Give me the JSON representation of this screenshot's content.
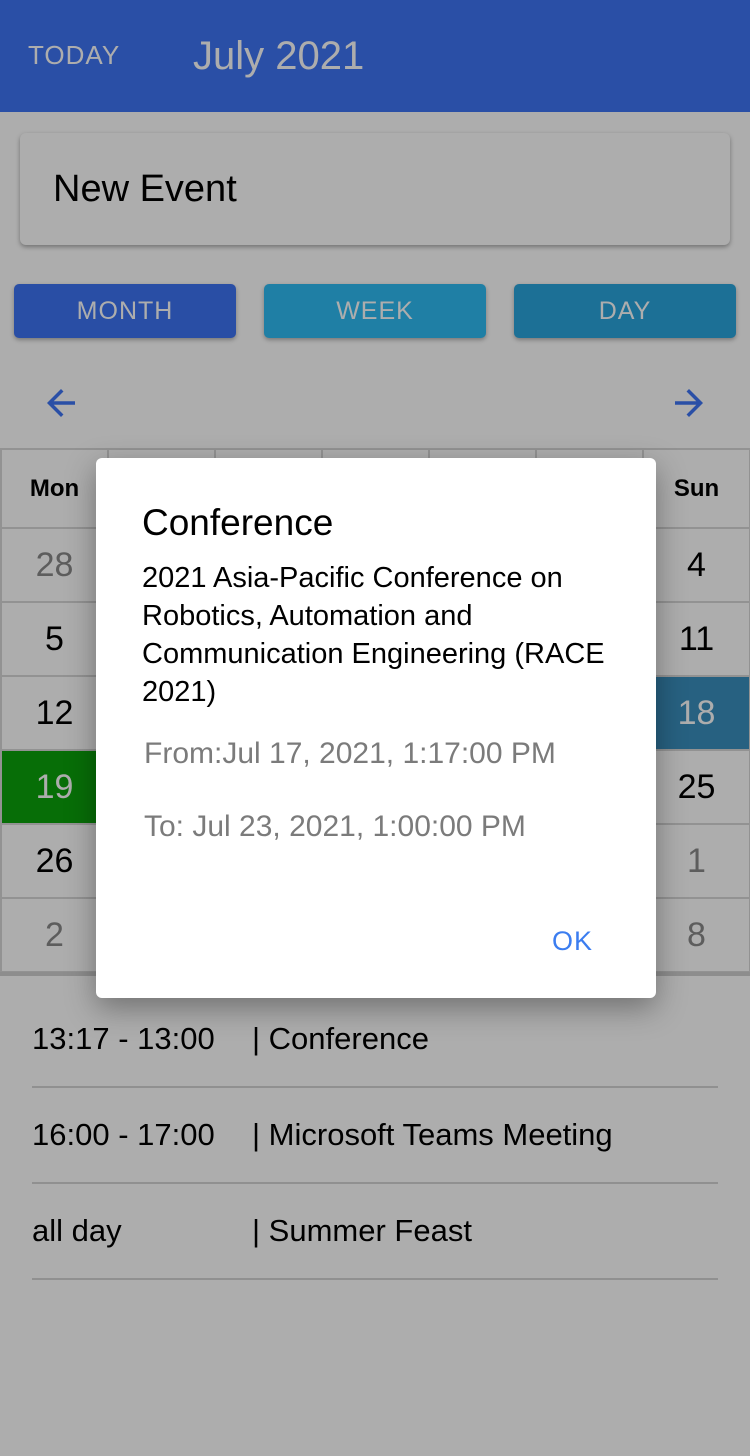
{
  "header": {
    "today_label": "TODAY",
    "title": "July 2021"
  },
  "new_event": {
    "label": "New Event"
  },
  "views": {
    "month": "MONTH",
    "week": "WEEK",
    "day": "DAY"
  },
  "nav": {
    "prev_icon": "arrow-left-icon",
    "next_icon": "arrow-right-icon"
  },
  "calendar": {
    "headers": [
      "Mon",
      "",
      "",
      "",
      "",
      "",
      "Sun"
    ],
    "weeks": [
      [
        "28",
        "",
        "",
        "",
        "",
        "",
        "4"
      ],
      [
        "5",
        "",
        "",
        "",
        "",
        "",
        "11"
      ],
      [
        "12",
        "",
        "",
        "",
        "",
        "",
        "18"
      ],
      [
        "19",
        "",
        "",
        "",
        "",
        "",
        "25"
      ],
      [
        "26",
        "",
        "",
        "",
        "",
        "",
        "1"
      ],
      [
        "2",
        "",
        "",
        "",
        "",
        "",
        "8"
      ]
    ]
  },
  "events": [
    {
      "time": "13:17 - 13:00",
      "title": "| Conference"
    },
    {
      "time": "16:00 - 17:00",
      "title": "| Microsoft Teams Meeting"
    },
    {
      "time": "all day",
      "title": "| Summer Feast"
    }
  ],
  "dialog": {
    "title": "Conference",
    "description": "2021 Asia-Pacific Conference on Robotics, Automation and Communication Engineering (RACE 2021)",
    "from": "From:Jul 17, 2021, 1:17:00 PM",
    "to": "To: Jul 23, 2021, 1:00:00 PM",
    "ok": "OK"
  },
  "colors": {
    "primary": "#3f75f5",
    "today": "#0ba20b",
    "selected": "#3a8fbf",
    "link": "#3b7df0"
  }
}
